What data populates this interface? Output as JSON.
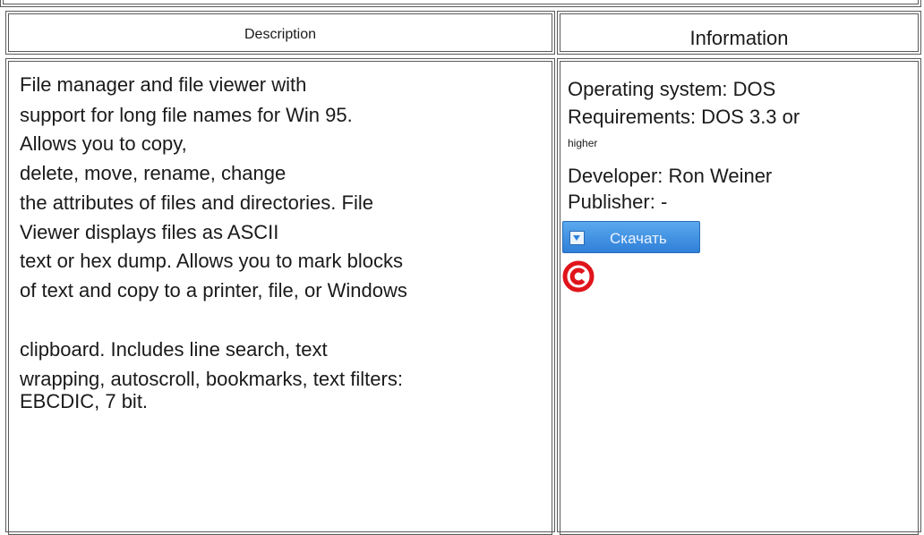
{
  "table": {
    "header": {
      "description": "Description",
      "information": "Information"
    },
    "description_lines": [
      "File manager and file viewer with",
      "support for long file names for Win 95.",
      "Allows you to copy,",
      "delete, move, rename, change",
      "the attributes of files and directories. File",
      "Viewer displays files as ASCII",
      "text or hex dump. Allows you to mark blocks",
      "of text and copy to a printer, file, or Windows",
      "clipboard. Includes line search, text",
      "wrapping, autoscroll, bookmarks, text filters:",
      "EBCDIC, 7 bit."
    ],
    "info": {
      "os": "Operating system: DOS",
      "requirements": "Requirements: DOS 3.3 or",
      "requirements_cont": "higher",
      "developer": "Developer: Ron Weiner",
      "publisher": "Publisher: -"
    },
    "download_label": "Скачать",
    "colors": {
      "button": "#2f7fd8",
      "copyright": "#e0141b"
    },
    "icons": [
      "download-icon",
      "copyright-icon"
    ]
  }
}
